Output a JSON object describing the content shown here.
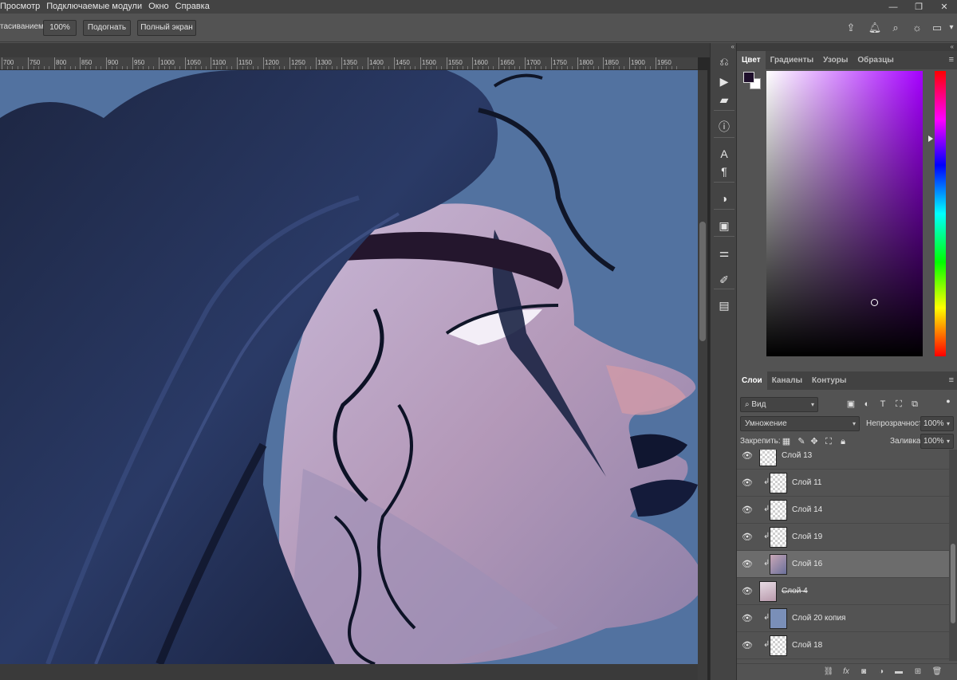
{
  "menu": {
    "items": [
      "Просмотр",
      "Подключаемые модули",
      "Окно",
      "Справка"
    ]
  },
  "window_controls": [
    "—",
    "❐",
    "✕"
  ],
  "options_bar": {
    "label": "тасиванием",
    "zoom_button": "100%",
    "fit_button": "Подогнать",
    "fullscreen_button": "Полный экран"
  },
  "ruler": {
    "labels": [
      "700",
      "750",
      "800",
      "850",
      "900",
      "950",
      "1000",
      "1050",
      "1100",
      "1150",
      "1200",
      "1250",
      "1300",
      "1350",
      "1400",
      "1450",
      "1500",
      "1550",
      "1600",
      "1650",
      "1700",
      "1750",
      "1800",
      "1850",
      "1900",
      "1950"
    ]
  },
  "toolstrip": {
    "collapse": "«",
    "icons": [
      "history-icon",
      "play-icon",
      "comment-icon",
      "info-icon",
      "character-icon",
      "paragraph-icon",
      "adjustments-icon",
      "libraries-icon",
      "properties-icon",
      "brush-settings-icon",
      "layer-comps-icon"
    ]
  },
  "color_panel": {
    "collapse": "«",
    "tabs": [
      "Цвет",
      "Градиенты",
      "Узоры",
      "Образцы"
    ],
    "active_tab": "Цвет",
    "foreground": "#1e0f2b",
    "background": "#ffffff",
    "hue_color": "#a500ff"
  },
  "layers_panel": {
    "tabs": [
      "Слои",
      "Каналы",
      "Контуры"
    ],
    "active_tab": "Слои",
    "filter_kind": "Вид",
    "blend_mode": "Умножение",
    "opacity_label": "Непрозрачность:",
    "opacity_value": "100%",
    "lock_label": "Закрепить:",
    "fill_label": "Заливка:",
    "fill_value": "100%",
    "layers": [
      {
        "name": "Слой 13",
        "visible": true,
        "clipped": false,
        "thumb": "transparent",
        "selected": false,
        "struck": false
      },
      {
        "name": "Слой 11",
        "visible": true,
        "clipped": true,
        "thumb": "transparent",
        "selected": false,
        "struck": false
      },
      {
        "name": "Слой 14",
        "visible": true,
        "clipped": true,
        "thumb": "transparent",
        "selected": false,
        "struck": false
      },
      {
        "name": "Слой 19",
        "visible": true,
        "clipped": true,
        "thumb": "transparent",
        "selected": false,
        "struck": false
      },
      {
        "name": "Слой 16",
        "visible": true,
        "clipped": true,
        "thumb": "art",
        "selected": true,
        "struck": false
      },
      {
        "name": "Слой 4",
        "visible": true,
        "clipped": false,
        "thumb": "figure",
        "selected": false,
        "struck": true
      },
      {
        "name": "Слой 20 копия",
        "visible": true,
        "clipped": true,
        "thumb": "blue",
        "selected": false,
        "struck": false
      },
      {
        "name": "Слой 18",
        "visible": true,
        "clipped": true,
        "thumb": "transparent",
        "selected": false,
        "struck": false
      }
    ],
    "footer_icons": [
      "link-icon",
      "fx-icon",
      "mask-icon",
      "adjustment-layer-icon",
      "group-folder-icon",
      "new-layer-icon",
      "trash-icon"
    ]
  }
}
